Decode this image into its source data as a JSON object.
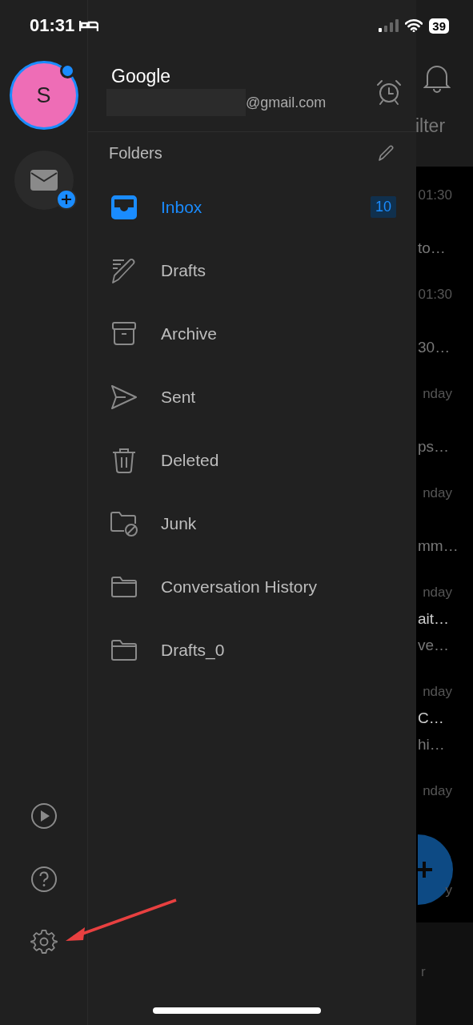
{
  "status_bar": {
    "time": "01:31",
    "battery": "39"
  },
  "account": {
    "initial": "S",
    "notification_dot": true,
    "name": "Google",
    "email": "@gmail.com"
  },
  "folders_header": {
    "title": "Folders"
  },
  "folders": [
    {
      "label": "Inbox",
      "kind": "inbox",
      "selected": true,
      "badge": "10"
    },
    {
      "label": "Drafts",
      "kind": "drafts",
      "selected": false
    },
    {
      "label": "Archive",
      "kind": "archive",
      "selected": false
    },
    {
      "label": "Sent",
      "kind": "sent",
      "selected": false
    },
    {
      "label": "Deleted",
      "kind": "deleted",
      "selected": false
    },
    {
      "label": "Junk",
      "kind": "junk",
      "selected": false
    },
    {
      "label": "Conversation History",
      "kind": "folder",
      "selected": false
    },
    {
      "label": "Drafts_0",
      "kind": "folder",
      "selected": false
    }
  ],
  "background": {
    "filter_label": "ilter",
    "messages": [
      {
        "date": "01:30",
        "preview": "to…"
      },
      {
        "date": "01:30",
        "preview": "30…"
      },
      {
        "date": "nday",
        "preview": "ps…"
      },
      {
        "date": "nday",
        "preview": "mm…"
      },
      {
        "date": "nday",
        "subject": "ait…",
        "preview": "ve…"
      },
      {
        "date": "nday",
        "subject": "C…",
        "preview": "hi…"
      },
      {
        "date": "nday"
      },
      {
        "date": "y"
      }
    ],
    "bottom_label": "r"
  }
}
